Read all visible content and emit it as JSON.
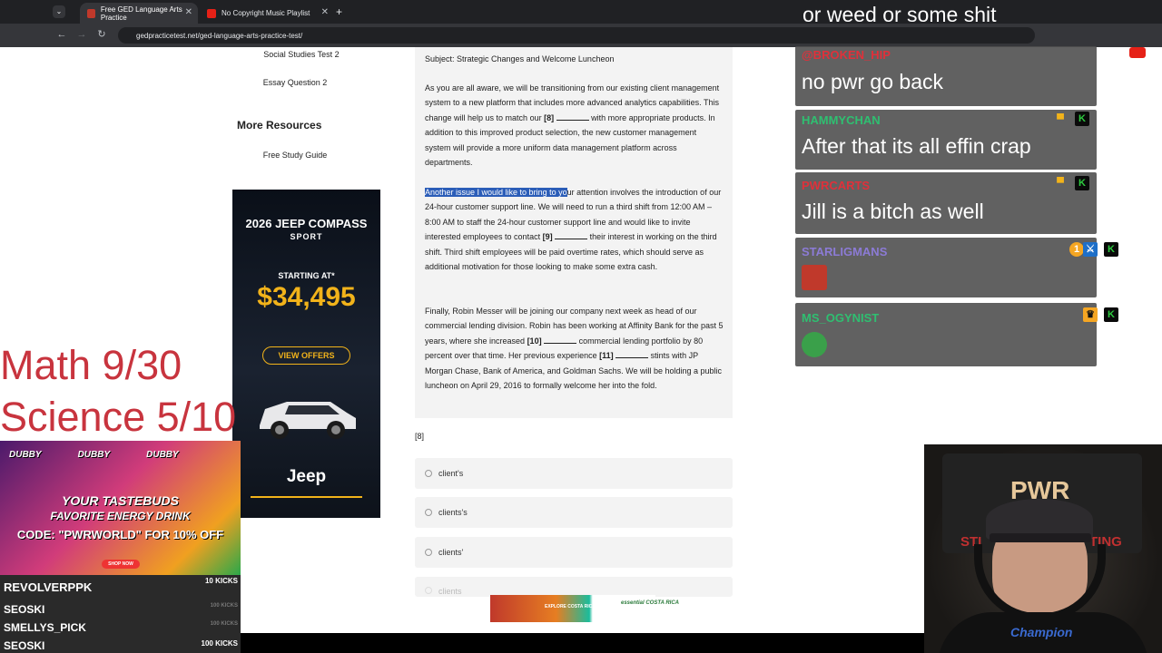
{
  "browser": {
    "tabs": [
      {
        "label": "Free GED Language Arts Practice",
        "active": true,
        "close": "✕"
      },
      {
        "label": "No Copyright Music Playlist",
        "active": false,
        "close": "✕"
      }
    ],
    "new_tab": "+",
    "url": "gedpracticetest.net/ged-language-arts-practice-test/",
    "nav": {
      "back": "←",
      "forward": "→",
      "reload": "↻"
    },
    "menu_icon": "⌄"
  },
  "sidebar": {
    "links": [
      "Social Studies Test 2",
      "Essay Question 2"
    ],
    "more_resources_heading": "More Resources",
    "study_guide": "Free Study Guide"
  },
  "ad_jeep": {
    "title": "2026 JEEP COMPASS",
    "subtitle": "SPORT",
    "starting": "STARTING AT*",
    "price": "$34,495",
    "cta": "VIEW OFFERS",
    "brand": "Jeep"
  },
  "article": {
    "subject": "Subject: Strategic Changes and Welcome Luncheon",
    "p1_a": "As you are all aware, we will be transitioning from our existing client management system to a new platform that includes more advanced analytics capabilities. This change will help us to match our ",
    "p1_b": " with more appropriate products. In addition to this improved product selection, the new customer management system will provide a more uniform data management platform across departments.",
    "p2_hl": "Another issue I would like to bring to yo",
    "p2_a": "ur attention involves the introduction of our 24-hour customer support line. We will need to run a third shift from 12:00 AM – 8:00 AM to staff the 24-hour customer support line and would like to invite interested employees to contact ",
    "p2_b": " their interest in working on the third shift. Third shift employees will be paid overtime rates, which should serve as additional motivation for those looking to make some extra cash.",
    "p3_a": "Finally, Robin Messer will be joining our company next week as head of our commercial lending division. Robin has been working at Affinity Bank for the past 5 years, where she increased ",
    "p3_b": " commercial lending portfolio by 80 percent over that time. Her previous experience ",
    "p3_c": " stints with JP Morgan Chase, Bank of America, and Goldman Sachs. We will be holding a public luncheon on April 29, 2016 to formally welcome her into the fold.",
    "marker8": "[8]",
    "marker9": "[9]",
    "marker10": "[10]",
    "marker11": "[11]"
  },
  "question": {
    "number": "[8]",
    "options": [
      "client's",
      "clients's",
      "clients'",
      "clients"
    ]
  },
  "ad_costa": {
    "text": "EXPLORE COSTA RICA",
    "logo": "essential COSTA RICA"
  },
  "chat": {
    "top_line": "or weed or some shit",
    "messages": [
      {
        "user": "@BROKEN_HIP",
        "user_color": "#e0303a",
        "text": "no pwr go back"
      },
      {
        "user": "HAMMYCHAN",
        "user_color": "#2fbf71",
        "text": "After that its all effin crap"
      },
      {
        "user": "PWRCARTS",
        "user_color": "#e0303a",
        "text": "Jill is a bitch as well"
      },
      {
        "user": "STARLIGMANS",
        "user_color": "#8c7bd6",
        "text": ""
      },
      {
        "user": "MS_OGYNIST",
        "user_color": "#2fbf71",
        "text": ""
      }
    ],
    "badge_k": "K",
    "badge_one": "1"
  },
  "stream": {
    "scores": [
      "Math 9/30",
      "Science 5/10"
    ],
    "dubby": {
      "cans": [
        "DUBBY",
        "DUBBY",
        "DUBBY"
      ],
      "line1": "YOUR TASTEBUDS",
      "line2": "FAVORITE ENERGY DRINK",
      "code": "CODE: \"PWRWORLD\" FOR 10% OFF",
      "shop": "SHOP NOW"
    },
    "donors": [
      {
        "name": "REVOLVERPPK",
        "amount": "10 KICKS"
      },
      {
        "name": "SEOSKI",
        "amount": "100 KICKS"
      },
      {
        "name": "SMELLYS_PICK",
        "amount": "100 KICKS"
      },
      {
        "name": "SEOSKI",
        "amount": "100 KICKS"
      }
    ],
    "banner": {
      "main": "PWR",
      "left": "STI",
      "right": "TING"
    },
    "shirt_logo": "Champion"
  }
}
